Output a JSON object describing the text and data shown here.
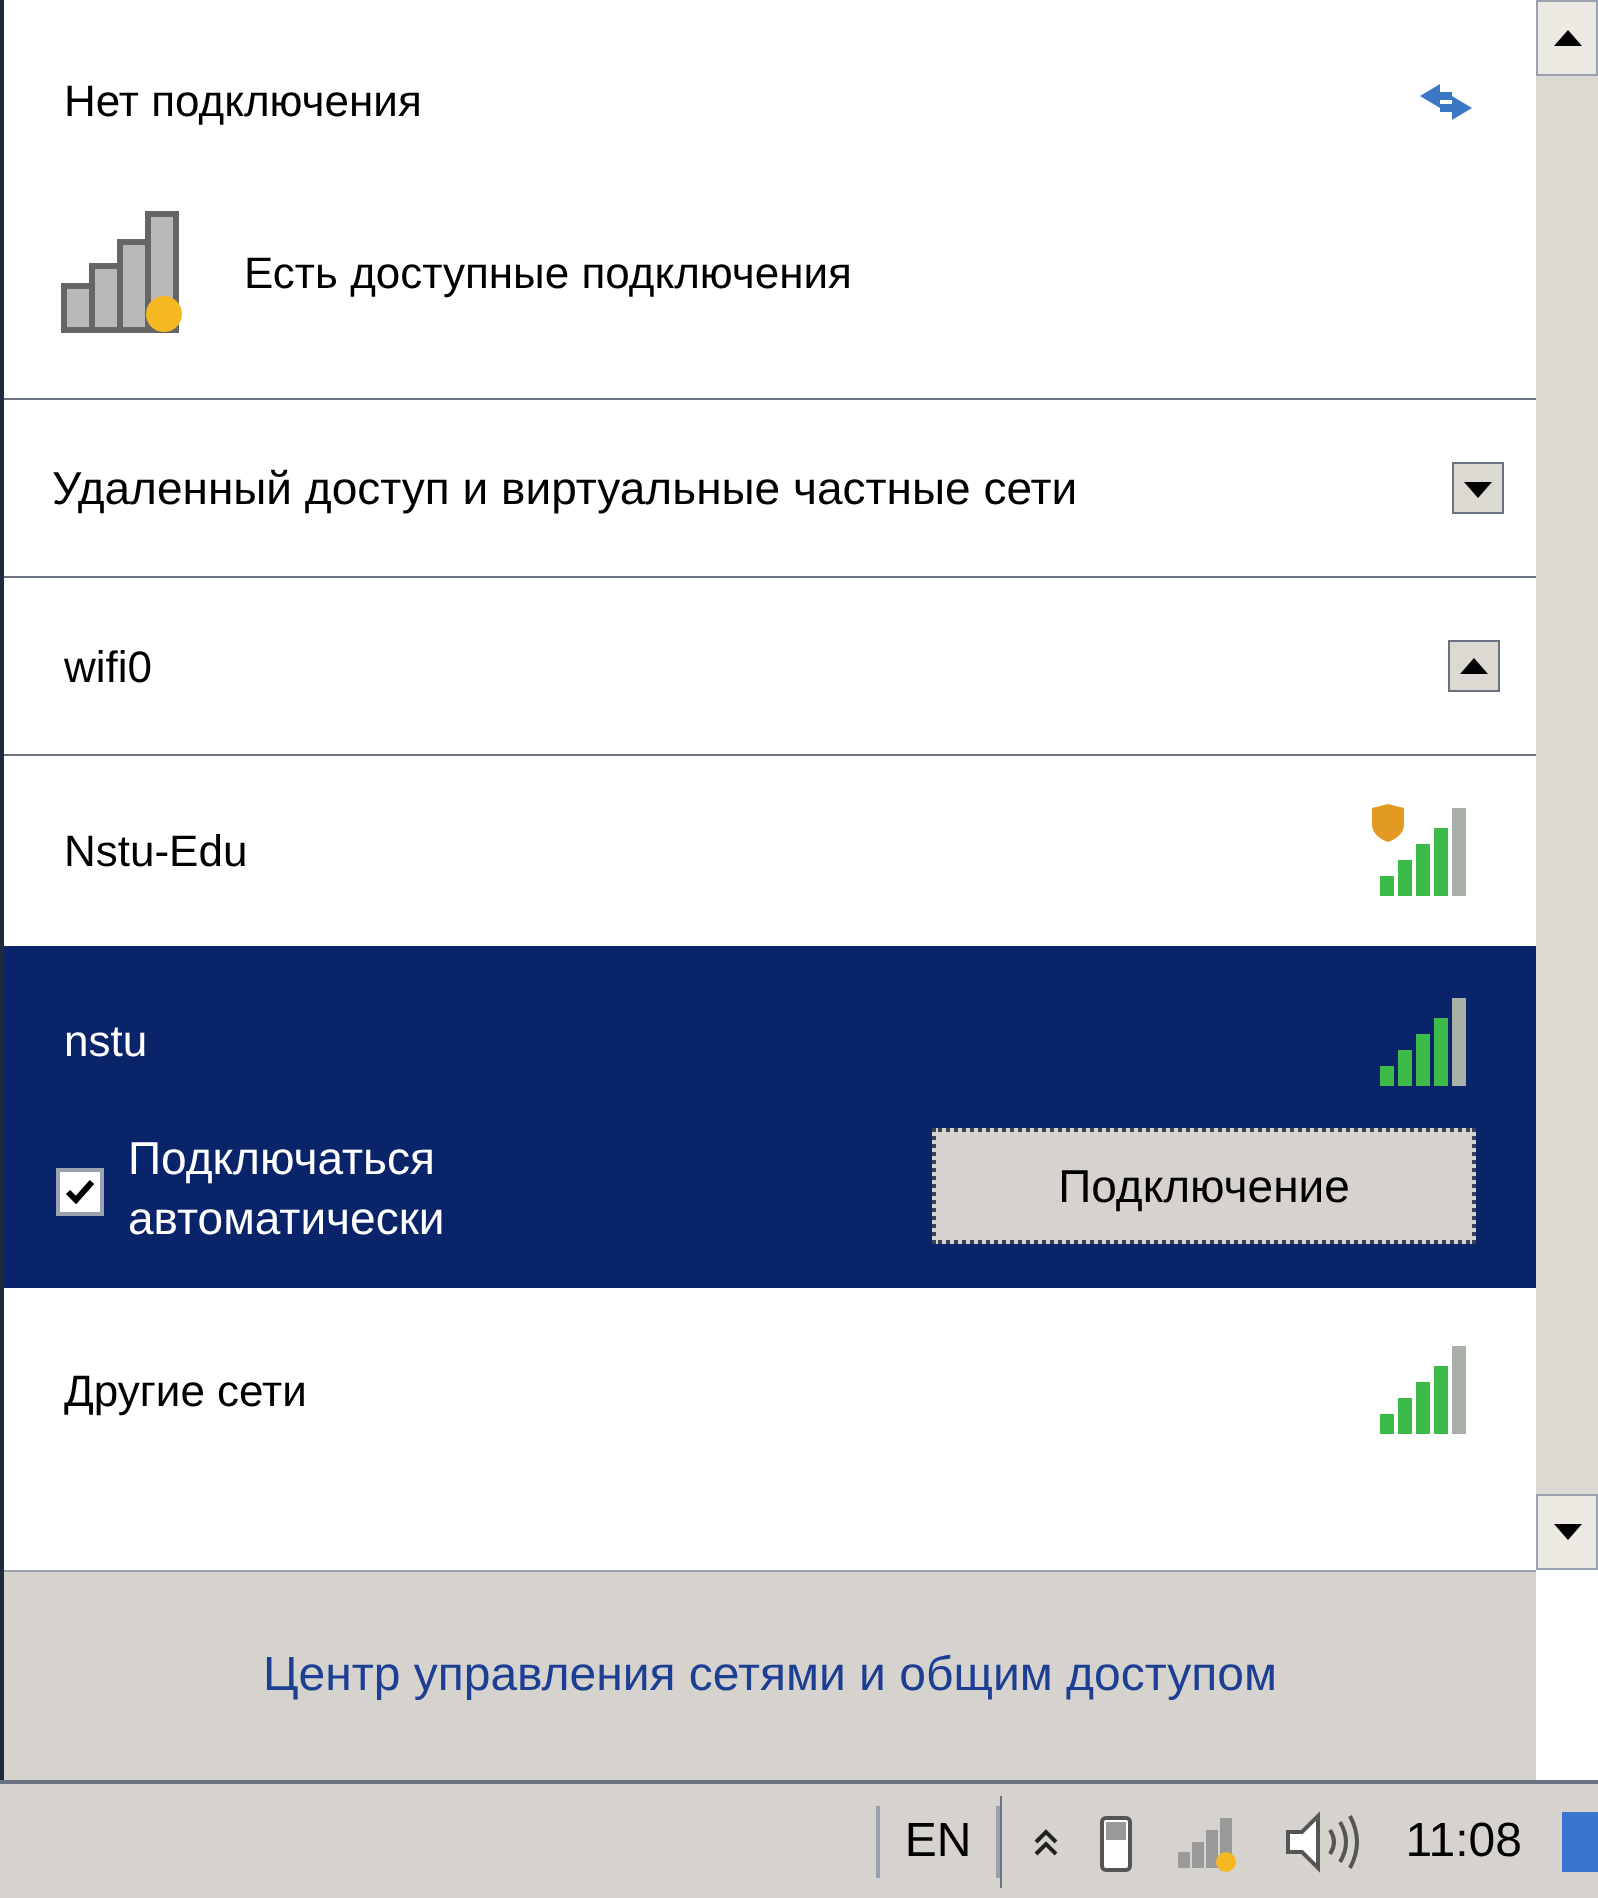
{
  "status": {
    "title": "Нет подключения",
    "subtitle": "Есть доступные подключения"
  },
  "groups": [
    {
      "name": "Удаленный доступ и виртуальные частные сети",
      "expanded": false
    },
    {
      "name": "wifi0",
      "expanded": true
    }
  ],
  "networks": [
    {
      "name": "Nstu-Edu",
      "secured": false,
      "selected": false
    },
    {
      "name": "nstu",
      "secured": true,
      "selected": true,
      "auto_connect": {
        "label": "Подключаться автоматически",
        "checked": true
      },
      "button": "Подключение"
    },
    {
      "name": "Другие сети",
      "secured": true,
      "selected": false
    }
  ],
  "footer_link": "Центр управления сетями и общим доступом",
  "taskbar": {
    "language": "EN",
    "clock": "11:08"
  }
}
